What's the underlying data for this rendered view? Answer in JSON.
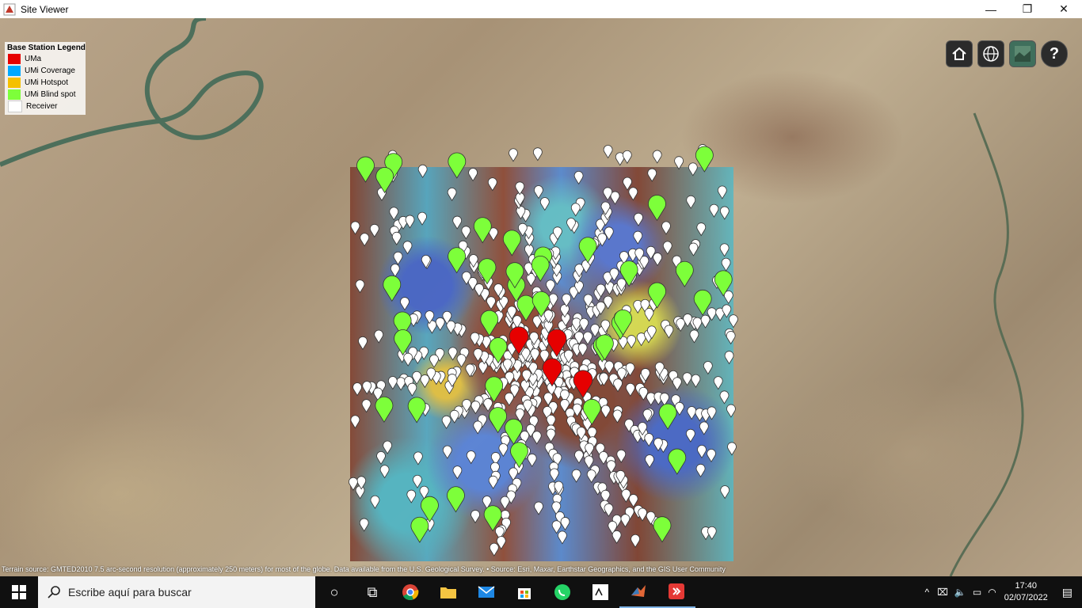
{
  "window": {
    "title": "Site Viewer",
    "minimize": "—",
    "restore": "❐",
    "close": "✕"
  },
  "legend": {
    "title": "Base Station Legend",
    "items": [
      {
        "label": "UMa",
        "color": "#e60000"
      },
      {
        "label": "UMi Coverage",
        "color": "#00a8ff"
      },
      {
        "label": "UMi Hotspot",
        "color": "#f5c000"
      },
      {
        "label": "UMi Blind spot",
        "color": "#7dff3a"
      },
      {
        "label": "Receiver",
        "color": "#ffffff"
      }
    ]
  },
  "toolbar": {
    "home_icon": "home-icon",
    "globe_icon": "globe-icon",
    "basemap_icon": "basemap-icon",
    "help_icon": "help-icon",
    "help_label": "?"
  },
  "attribution": "Terrain source: GMTED2010 7.5 arc-second resolution (approximately 250 meters) for most of the globe. Data available from the U.S. Geological Survey. • Source: Esri, Maxar, Earthstar Geographics, and the GIS User Community",
  "taskbar": {
    "search_placeholder": "Escribe aquí para buscar",
    "time": "17:40",
    "date": "02/07/2022"
  }
}
